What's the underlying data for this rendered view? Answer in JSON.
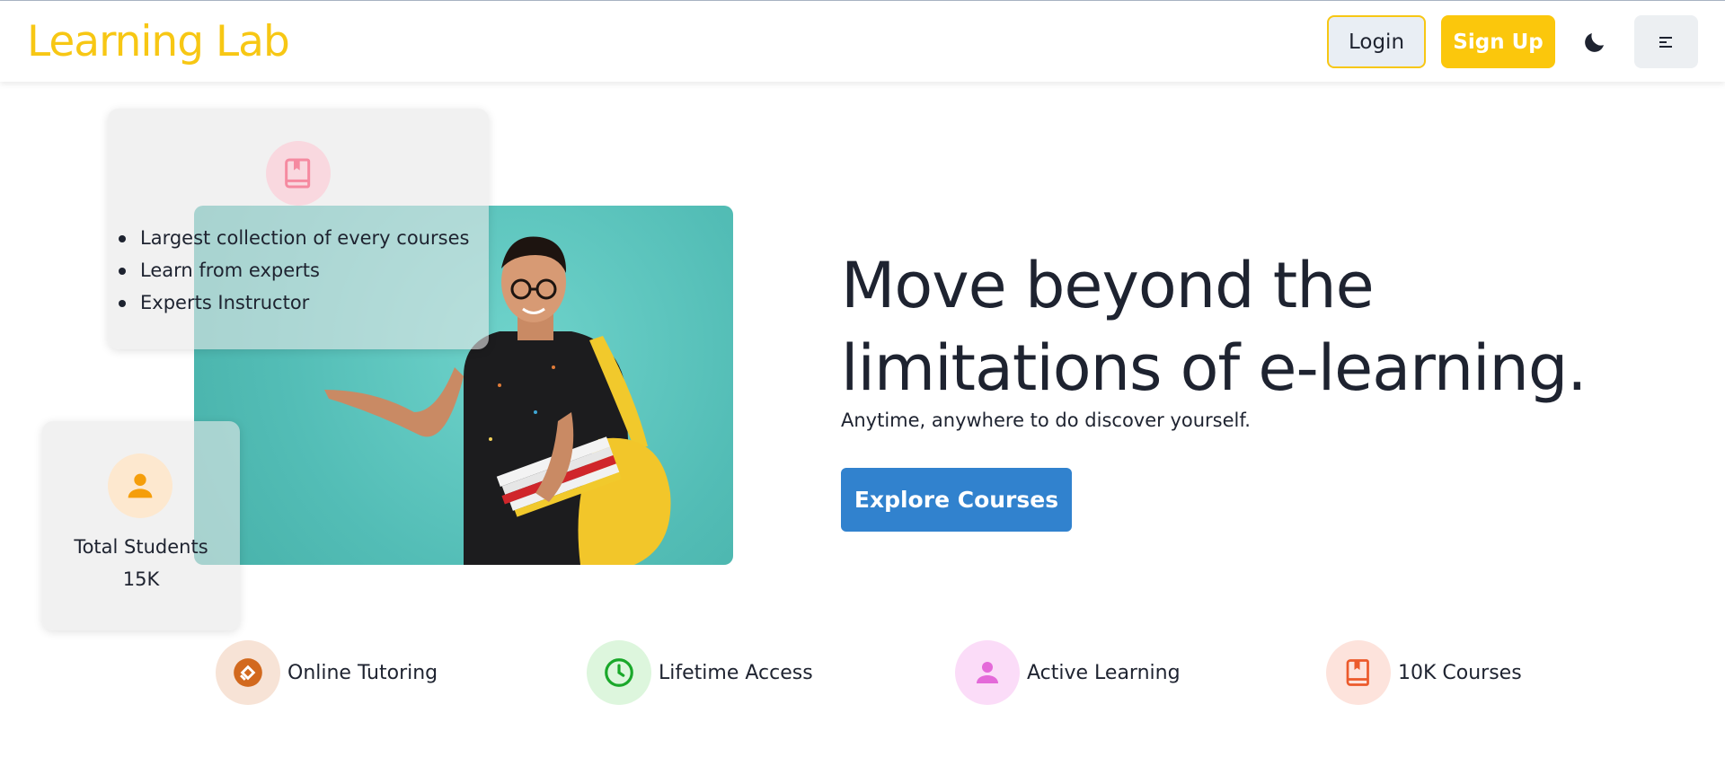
{
  "header": {
    "logo": "Learning Lab",
    "login_label": "Login",
    "signup_label": "Sign Up"
  },
  "features_card": {
    "items": [
      "Largest collection of every courses",
      "Learn from experts",
      "Experts Instructor"
    ]
  },
  "students_card": {
    "label": "Total Students",
    "value": "15K"
  },
  "hero": {
    "title": "Move beyond the limitations of e-learning.",
    "subtitle": "Anytime, anywhere to do discover yourself.",
    "cta_label": "Explore Courses"
  },
  "features": [
    {
      "label": "Online Tutoring",
      "icon": "tutoring-icon",
      "color": "#d2691e",
      "bg": "#f7e3d6"
    },
    {
      "label": "Lifetime Access",
      "icon": "clock-icon",
      "color": "#1aa82a",
      "bg": "#ddf6dd"
    },
    {
      "label": "Active Learning",
      "icon": "user-icon",
      "color": "#e46ad9",
      "bg": "#fbdcf8"
    },
    {
      "label": "10K Courses",
      "icon": "book-icon",
      "color": "#ec5a2b",
      "bg": "#fde3dc"
    }
  ],
  "colors": {
    "brand_yellow": "#f7c714",
    "primary_blue": "#3182ce",
    "text_dark": "#1e2330"
  }
}
